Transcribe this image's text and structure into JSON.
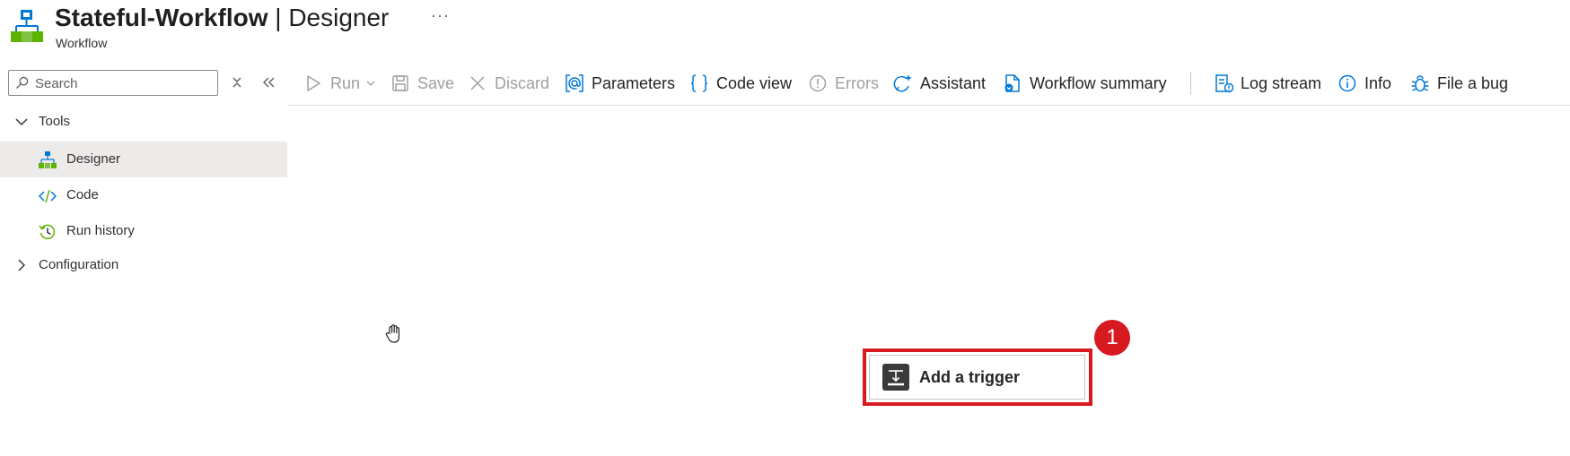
{
  "header": {
    "title_name": "Stateful-Workflow",
    "title_separator": " | ",
    "title_section": "Designer",
    "subtitle": "Workflow",
    "more_label": "···"
  },
  "sidebar": {
    "search": {
      "placeholder": "Search",
      "value": ""
    },
    "groups": [
      {
        "label": "Tools",
        "expanded": true,
        "items": [
          {
            "label": "Designer",
            "icon": "workflow-designer-icon",
            "selected": true
          },
          {
            "label": "Code",
            "icon": "code-icon",
            "selected": false
          },
          {
            "label": "Run history",
            "icon": "history-icon",
            "selected": false
          }
        ]
      },
      {
        "label": "Configuration",
        "expanded": false
      }
    ]
  },
  "toolbar": {
    "run": "Run",
    "save": "Save",
    "discard": "Discard",
    "parameters": "Parameters",
    "code_view": "Code view",
    "errors": "Errors",
    "assistant": "Assistant",
    "workflow_summary": "Workflow summary",
    "log_stream": "Log stream",
    "info": "Info",
    "file_bug": "File a bug"
  },
  "canvas": {
    "add_trigger_label": "Add a trigger",
    "step_badge": "1"
  },
  "colors": {
    "accent_blue": "#0078d4",
    "highlight_red": "#d71920",
    "selected_bg": "#edebe9",
    "disabled_text": "#a19f9d",
    "workflow_green": "#5db300"
  }
}
